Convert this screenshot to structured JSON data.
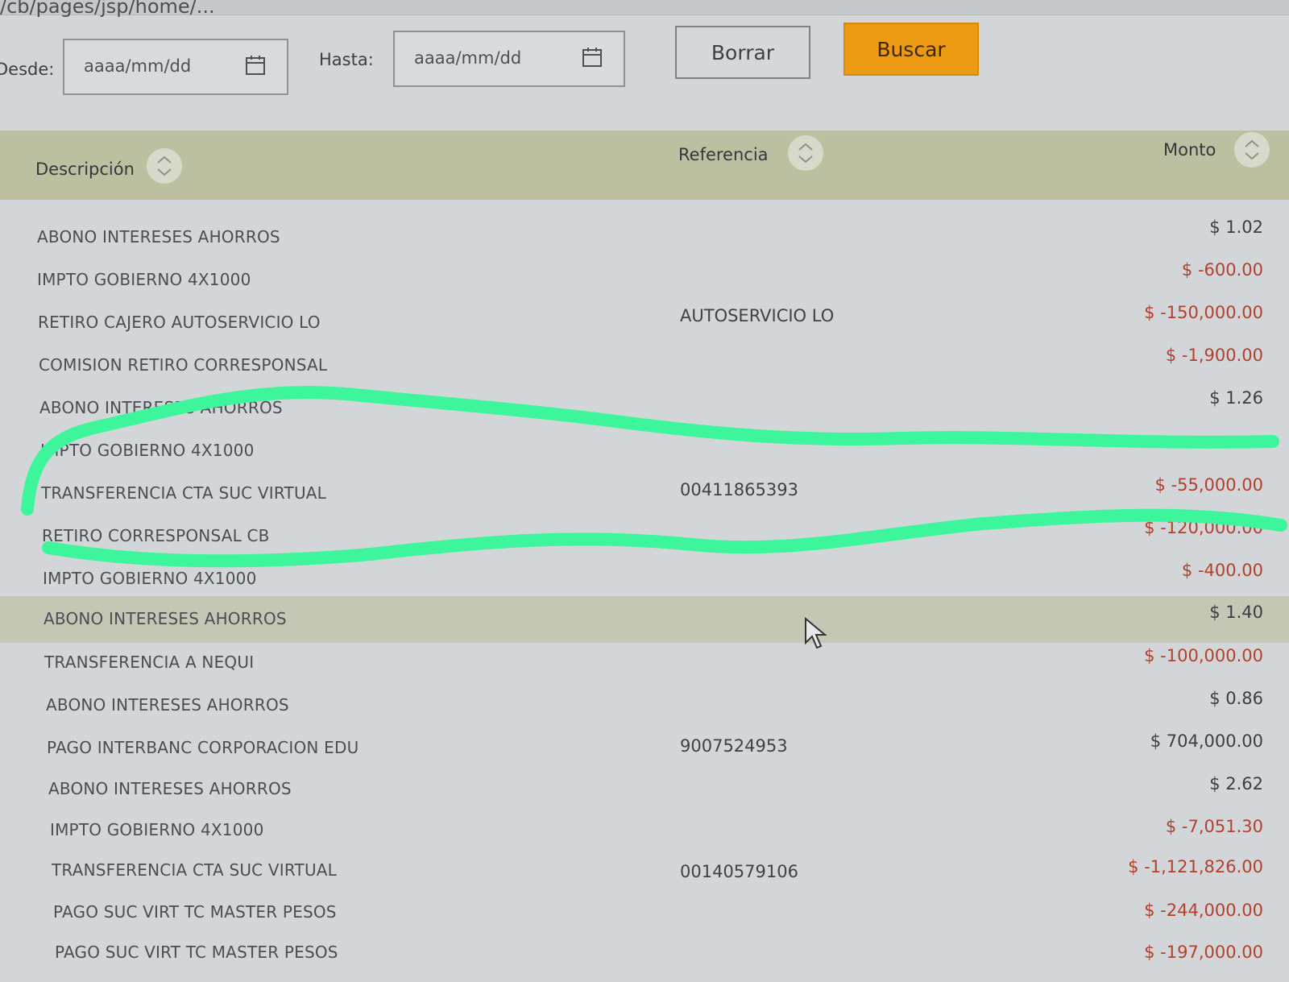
{
  "browser": {
    "url_fragment": "/cb/pages/jsp/home/..."
  },
  "filters": {
    "desde_label": "Desde:",
    "desde_placeholder": "aaaa/mm/dd",
    "hasta_label": "Hasta:",
    "hasta_placeholder": "aaaa/mm/dd",
    "borrar_label": "Borrar",
    "buscar_label": "Buscar"
  },
  "table": {
    "headers": {
      "descripcion": "Descripción",
      "referencia": "Referencia",
      "monto": "Monto"
    },
    "rows": [
      {
        "descripcion": "ABONO INTERESES AHORROS",
        "referencia": "",
        "monto": "$ 1.02"
      },
      {
        "descripcion": "IMPTO GOBIERNO 4X1000",
        "referencia": "",
        "monto": "$ -600.00"
      },
      {
        "descripcion": "RETIRO CAJERO AUTOSERVICIO LO",
        "referencia": "AUTOSERVICIO LO",
        "monto": "$ -150,000.00"
      },
      {
        "descripcion": "COMISION RETIRO CORRESPONSAL",
        "referencia": "",
        "monto": "$ -1,900.00"
      },
      {
        "descripcion": "ABONO INTERESES AHORROS",
        "referencia": "",
        "monto": "$ 1.26"
      },
      {
        "descripcion": "IMPTO GOBIERNO 4X1000",
        "referencia": "",
        "monto": ""
      },
      {
        "descripcion": "TRANSFERENCIA CTA SUC VIRTUAL",
        "referencia": "00411865393",
        "monto": "$ -55,000.00"
      },
      {
        "descripcion": "RETIRO CORRESPONSAL CB",
        "referencia": "",
        "monto": "$ -120,000.00"
      },
      {
        "descripcion": "IMPTO GOBIERNO 4X1000",
        "referencia": "",
        "monto": "$ -400.00"
      },
      {
        "descripcion": "ABONO INTERESES AHORROS",
        "referencia": "",
        "monto": "$ 1.40"
      },
      {
        "descripcion": "TRANSFERENCIA A NEQUI",
        "referencia": "",
        "monto": "$ -100,000.00"
      },
      {
        "descripcion": "ABONO INTERESES AHORROS",
        "referencia": "",
        "monto": "$ 0.86"
      },
      {
        "descripcion": "PAGO INTERBANC CORPORACION EDU",
        "referencia": "9007524953",
        "monto": "$ 704,000.00"
      },
      {
        "descripcion": "ABONO INTERESES AHORROS",
        "referencia": "",
        "monto": "$ 2.62"
      },
      {
        "descripcion": "IMPTO GOBIERNO 4X1000",
        "referencia": "",
        "monto": "$ -7,051.30"
      },
      {
        "descripcion": "TRANSFERENCIA CTA SUC VIRTUAL",
        "referencia": "00140579106",
        "monto": "$ -1,121,826.00"
      },
      {
        "descripcion": "PAGO SUC VIRT TC MASTER PESOS",
        "referencia": "",
        "monto": "$ -244,000.00"
      },
      {
        "descripcion": "PAGO SUC VIRT TC MASTER PESOS",
        "referencia": "",
        "monto": "$ -197,000.00"
      }
    ]
  },
  "colors": {
    "header_band": "#bcc0a0",
    "buscar_button": "#ec9a12",
    "negative_amount": "#b2402e",
    "scribble": "#3df59a"
  },
  "icons": {
    "date_picker": "calendar-icon",
    "sort": "sort-icon",
    "pointer": "mouse-cursor-icon"
  }
}
